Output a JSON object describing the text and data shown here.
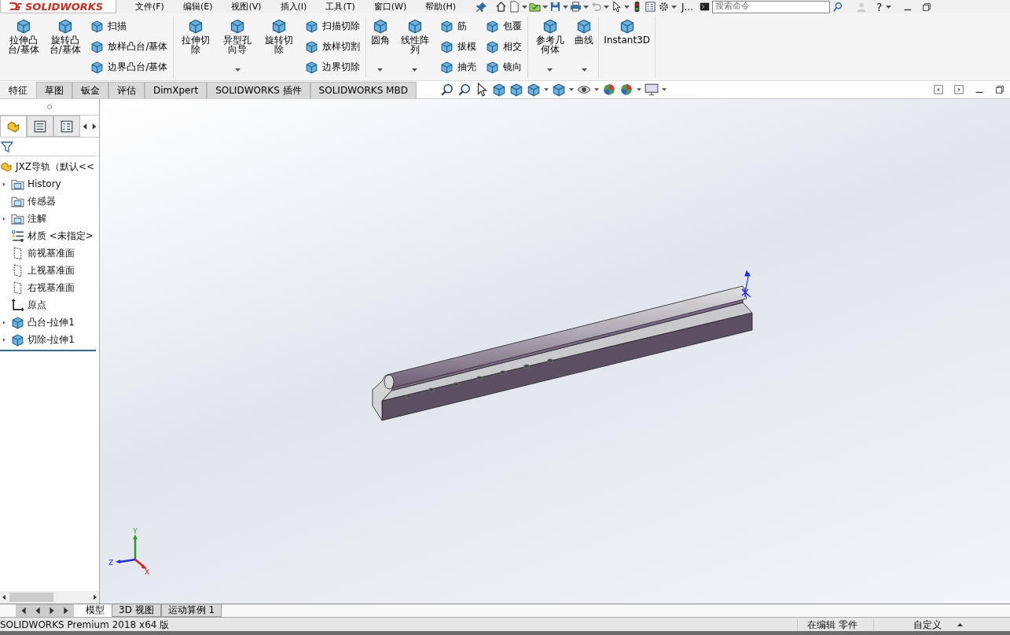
{
  "app_logo": "SOLIDWORKS",
  "menu": [
    "文件(F)",
    "编辑(E)",
    "视图(V)",
    "插入(I)",
    "工具(T)",
    "窗口(W)",
    "帮助(H)"
  ],
  "quick_access": {
    "overflow_label": "J...",
    "search_placeholder": "搜索命令",
    "help": "?"
  },
  "ribbon": [
    {
      "columns": [
        {
          "kind": "large",
          "label": "拉伸凸台/基体",
          "dropdown": false
        },
        {
          "kind": "large",
          "label": "旋转凸台/基体",
          "dropdown": false
        },
        {
          "kind": "stack",
          "items": [
            "扫描",
            "放样凸台/基体",
            "边界凸台/基体"
          ]
        }
      ]
    },
    {
      "columns": [
        {
          "kind": "large",
          "label": "拉伸切除",
          "dropdown": false
        },
        {
          "kind": "large",
          "label": "异型孔向导",
          "dropdown": true
        },
        {
          "kind": "large",
          "label": "旋转切除",
          "dropdown": false
        },
        {
          "kind": "stack",
          "items": [
            "扫描切除",
            "放样切割",
            "边界切除"
          ]
        }
      ]
    },
    {
      "columns": [
        {
          "kind": "large",
          "label": "圆角",
          "dropdown": true
        },
        {
          "kind": "large",
          "label": "线性阵列",
          "dropdown": true
        },
        {
          "kind": "stack",
          "items": [
            "筋",
            "拔模",
            "抽壳"
          ]
        },
        {
          "kind": "stack",
          "items": [
            "包覆",
            "相交",
            "镜向"
          ]
        }
      ]
    },
    {
      "columns": [
        {
          "kind": "large",
          "label": "参考几何体",
          "dropdown": true
        },
        {
          "kind": "large",
          "label": "曲线",
          "dropdown": true
        }
      ]
    },
    {
      "columns": [
        {
          "kind": "large",
          "label": "Instant3D",
          "dropdown": false
        }
      ]
    }
  ],
  "command_tabs": [
    {
      "label": "特征",
      "selected": true
    },
    {
      "label": "草图",
      "selected": false
    },
    {
      "label": "钣金",
      "selected": false
    },
    {
      "label": "评估",
      "selected": false
    },
    {
      "label": "DimXpert",
      "selected": false
    },
    {
      "label": "SOLIDWORKS 插件",
      "selected": false
    },
    {
      "label": "SOLIDWORKS MBD",
      "selected": false
    }
  ],
  "manager_tabs": [
    {
      "selected": true
    },
    {
      "selected": false
    },
    {
      "selected": false
    }
  ],
  "feature_tree": {
    "root": "JXZ导轨（默认<<",
    "items": [
      {
        "kind": "folder",
        "label": "History",
        "expandable": true
      },
      {
        "kind": "folder",
        "label": "传感器",
        "expandable": false
      },
      {
        "kind": "folder",
        "label": "注解",
        "expandable": true
      },
      {
        "kind": "material",
        "label": "材质 <未指定>",
        "expandable": false
      },
      {
        "kind": "plane",
        "label": "前视基准面",
        "expandable": false
      },
      {
        "kind": "plane",
        "label": "上视基准面",
        "expandable": false
      },
      {
        "kind": "plane",
        "label": "右视基准面",
        "expandable": false
      },
      {
        "kind": "origin",
        "label": "原点",
        "expandable": false
      },
      {
        "kind": "feature",
        "label": "凸台-拉伸1",
        "expandable": true
      },
      {
        "kind": "feature",
        "label": "切除-拉伸1",
        "expandable": true
      }
    ]
  },
  "triad_labels": [
    "Y",
    "Z",
    "X"
  ],
  "sheet_tabs": [
    {
      "label": "模型",
      "selected": true
    },
    {
      "label": "3D 视图",
      "selected": false
    },
    {
      "label": "运动算例 1",
      "selected": false
    }
  ],
  "status_bar": {
    "product": "SOLIDWORKS Premium 2018 x64 版",
    "mode": "在编辑 零件",
    "units": "自定义"
  }
}
